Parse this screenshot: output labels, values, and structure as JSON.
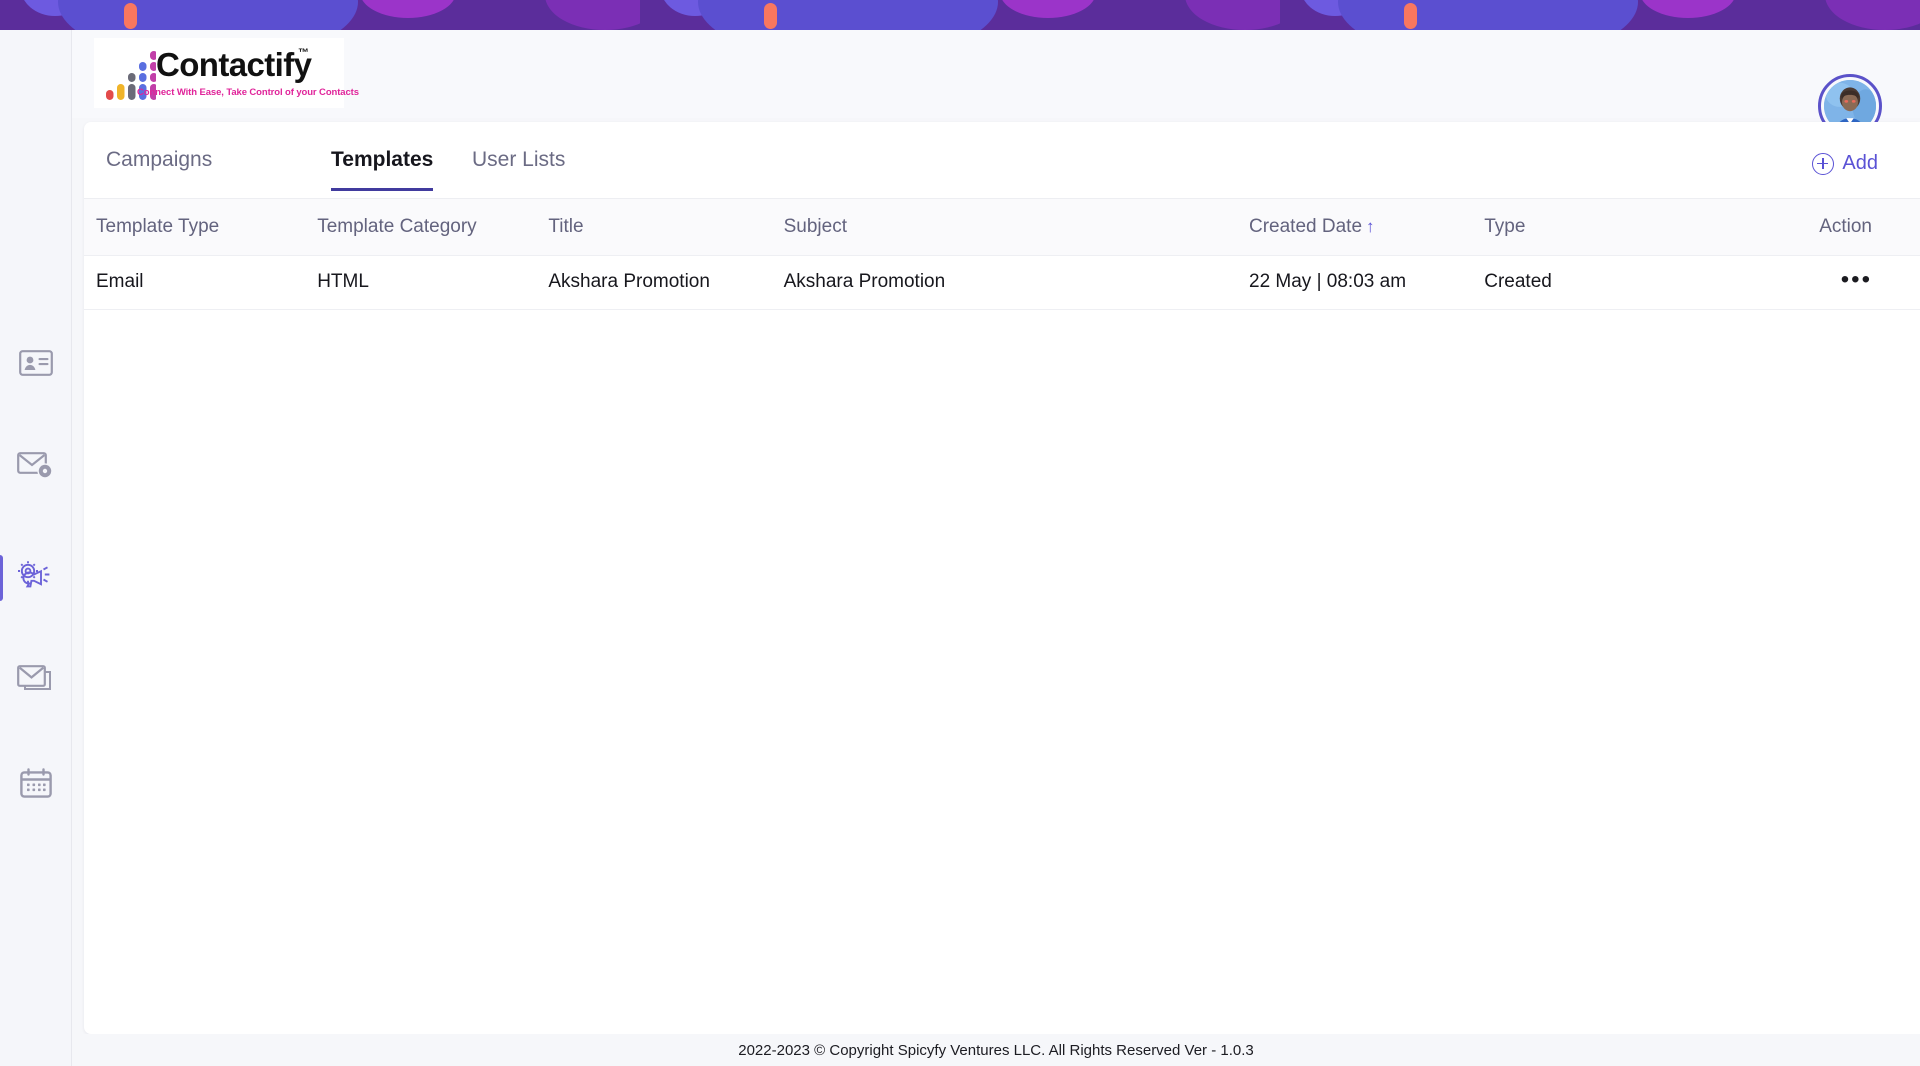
{
  "brand": {
    "name": "Contactify",
    "trademark": "™",
    "tagline": "Connect With Ease, Take Control of your Contacts",
    "accent_color": "#5a52d5",
    "logo_pink": "#e0249a"
  },
  "sidebar": {
    "items": [
      {
        "name": "contacts",
        "icon": "contact-card-icon",
        "active": false
      },
      {
        "name": "email-settings",
        "icon": "envelope-gear-icon",
        "active": false
      },
      {
        "name": "campaigns",
        "icon": "gear-megaphone-icon",
        "active": true
      },
      {
        "name": "templates",
        "icon": "stacked-envelope-icon",
        "active": false
      },
      {
        "name": "schedule",
        "icon": "calendar-icon",
        "active": false
      }
    ]
  },
  "header": {
    "avatar_label": "user-avatar"
  },
  "tabs": [
    {
      "label": "Campaigns",
      "active": false
    },
    {
      "label": "Templates",
      "active": true
    },
    {
      "label": "User Lists",
      "active": false
    }
  ],
  "toolbar": {
    "add_label": "Add",
    "add_icon": "plus-circle-icon"
  },
  "table": {
    "columns": [
      {
        "label": "Template Type",
        "sorted": false
      },
      {
        "label": "Template Category",
        "sorted": false
      },
      {
        "label": "Title",
        "sorted": false
      },
      {
        "label": "Subject",
        "sorted": false
      },
      {
        "label": "Created Date",
        "sorted": true,
        "sort_indicator": "↑"
      },
      {
        "label": "Type",
        "sorted": false
      },
      {
        "label": "Action",
        "sorted": false
      }
    ],
    "rows": [
      {
        "template_type": "Email",
        "template_category": "HTML",
        "title": "Akshara Promotion",
        "subject": "Akshara Promotion",
        "created_date": "22 May | 08:03 am",
        "type": "Created",
        "action": "•••"
      }
    ]
  },
  "footer": {
    "text": "2022-2023 © Copyright Spicyfy Ventures LLC. All Rights Reserved  Ver - 1.0.3"
  }
}
